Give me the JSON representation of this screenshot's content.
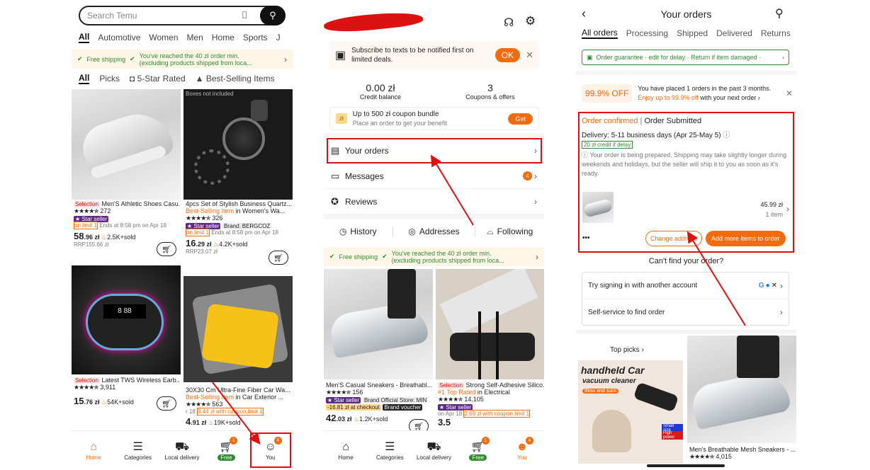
{
  "colors": {
    "accent": "#f26b0f",
    "annotation": "#e01010",
    "green": "#2e8b2e",
    "purple": "#5b2b82"
  },
  "p1": {
    "search_placeholder": "Search Temu",
    "cats": [
      "All",
      "Automotive",
      "Women",
      "Men",
      "Home",
      "Sports",
      "J"
    ],
    "promo_free": "Free shipping",
    "promo_min": "You've reached the 40 zł order min.",
    "promo_min2": "(excluding products shipped from loca...",
    "filters": [
      "All",
      "Picks",
      "5-Star Rated",
      "Best-Selling Items"
    ],
    "prod1": {
      "tag": "Selection",
      "title": "Men'S Athletic Shoes Casu...",
      "rating": "272",
      "badge": "Star seller",
      "limit": "on,limit 1",
      "ends": "Ends at 8:58 pm on Apr 18",
      "price_int": "58",
      "price_dec": ".96 zł",
      "sold": "2.5K+sold",
      "rrp": "RRP155.66 zł"
    },
    "prod2": {
      "boxnote": "Boxes not included",
      "title": "4pcs Set of Stylish Business Quartz...",
      "best": "Best-Selling Item",
      "best_in": "in Women's Wa...",
      "rating": "326",
      "badge": "Star seller",
      "brand": "Brand: BERGCOZ",
      "limit": "on,limit 1",
      "ends": "Ends at 8:58 pm on Apr 18",
      "price_int": "16",
      "price_dec": ".29 zł",
      "sold": "4.2K+sold",
      "rrp": "RRP23.07 zł"
    },
    "prod3": {
      "tag": "Selection",
      "title": "Latest TWS Wireless Earb...",
      "rating": "3,911",
      "price_int": "15",
      "price_dec": ".76 zł",
      "sold": "54K+sold"
    },
    "prod4": {
      "title": "30X30 Cm Ultra-Fine Fiber Car Wa...",
      "best": "Best-Selling Item",
      "best_in": "in Car Exterior ...",
      "rating": "563",
      "limit": "3.44 zł with coupon,limit 1",
      "r18": "r 18",
      "price_int": "4",
      "price_dec": ".91 zł",
      "sold": "19K+sold"
    },
    "nav": [
      {
        "label": "Home",
        "icon": "home-icon"
      },
      {
        "label": "Categories",
        "icon": "categories-icon"
      },
      {
        "label": "Local delivery",
        "icon": "truck-icon"
      },
      {
        "label": "Free",
        "icon": "cart-icon"
      },
      {
        "label": "You",
        "icon": "user-icon"
      }
    ],
    "cart_badge": "1",
    "you_badge": "4"
  },
  "p2": {
    "subscribe": "Subscribe to texts to be notified first on limited deals.",
    "ok": "OK",
    "credit_val": "0.00 zł",
    "credit_lbl": "Credit balance",
    "coupons_val": "3",
    "coupons_lbl": "Coupons & offers",
    "coupon_title": "Up to 500 zł coupon bundle",
    "coupon_sub": "Place an order to get your benefit",
    "coupon_icon": "zł",
    "get": "Get",
    "menu": [
      "Your orders",
      "Messages",
      "Reviews"
    ],
    "msg_badge": "4",
    "tabs": [
      "History",
      "Addresses",
      "Following"
    ],
    "promo_free": "Free shipping",
    "promo_min": "You've reached the 40 zł order min.",
    "promo_min2": "(excluding products shipped from loca...",
    "prod1": {
      "title": "Men'S Casual Sneakers - Breathabl...",
      "rating": "156",
      "badge": "Star seller",
      "store": "Brand Official Store: MIN",
      "checkout": "-16.81 zł at checkout",
      "voucher": "Brand voucher",
      "price_int": "42",
      "price_dec": ".03 zł",
      "sold": "1.2K+sold"
    },
    "prod2": {
      "tag": "Selection",
      "title": "Strong Self-Adhesive Silico...",
      "toprated": "#1 Top Rated",
      "in": "in Electrical",
      "rating": "14,105",
      "badge": "Star seller",
      "ends": "on Apr 18",
      "limit": "2.69 zł with coupon,limit 1",
      "price_partial": "3.5"
    },
    "nav": [
      {
        "label": "Home"
      },
      {
        "label": "Categories"
      },
      {
        "label": "Local delivery"
      },
      {
        "label": "Free"
      },
      {
        "label": "You"
      }
    ],
    "cart_badge": "1",
    "you_badge": "4"
  },
  "p3": {
    "title": "Your orders",
    "tabs": [
      "All orders",
      "Processing",
      "Shipped",
      "Delivered",
      "Returns"
    ],
    "guarantee": "Order guarantee · edit for delay · Return if item damaged ·",
    "off": "99.9% OFF",
    "placed": "You have placed 1 orders in the past 3 months.",
    "enjoy_pre": "Enjoy up to 99.9% off",
    "enjoy_post": "with your next order",
    "status1": "Order confirmed",
    "status2": "Order Submitted",
    "delivery": "Delivery: 5-11 business days (Apr 25-May 5)",
    "credit": "20 zł credit if delay",
    "note": "Your order is being prepared. Shipping may take slightly longer during weekends and holidays, but the seller will ship it to you as soon as it's ready.",
    "price": "45.99 zł",
    "items": "1 item",
    "more": "•••",
    "change": "Change address",
    "add": "Add more items to order",
    "cant": "Can't find your order?",
    "signin": "Try signing in with another account",
    "selfservice": "Self-service to find order",
    "toppicks": "Top picks",
    "ad1": "handheld Car",
    "ad2": "vacuum cleaner",
    "ad3": "Blow and suck",
    "ad_small": "Small size",
    "ad_high": "High power",
    "prod": {
      "title": "Men's Breathable Mesh Sneakers - ...",
      "rating": "4,015"
    }
  }
}
